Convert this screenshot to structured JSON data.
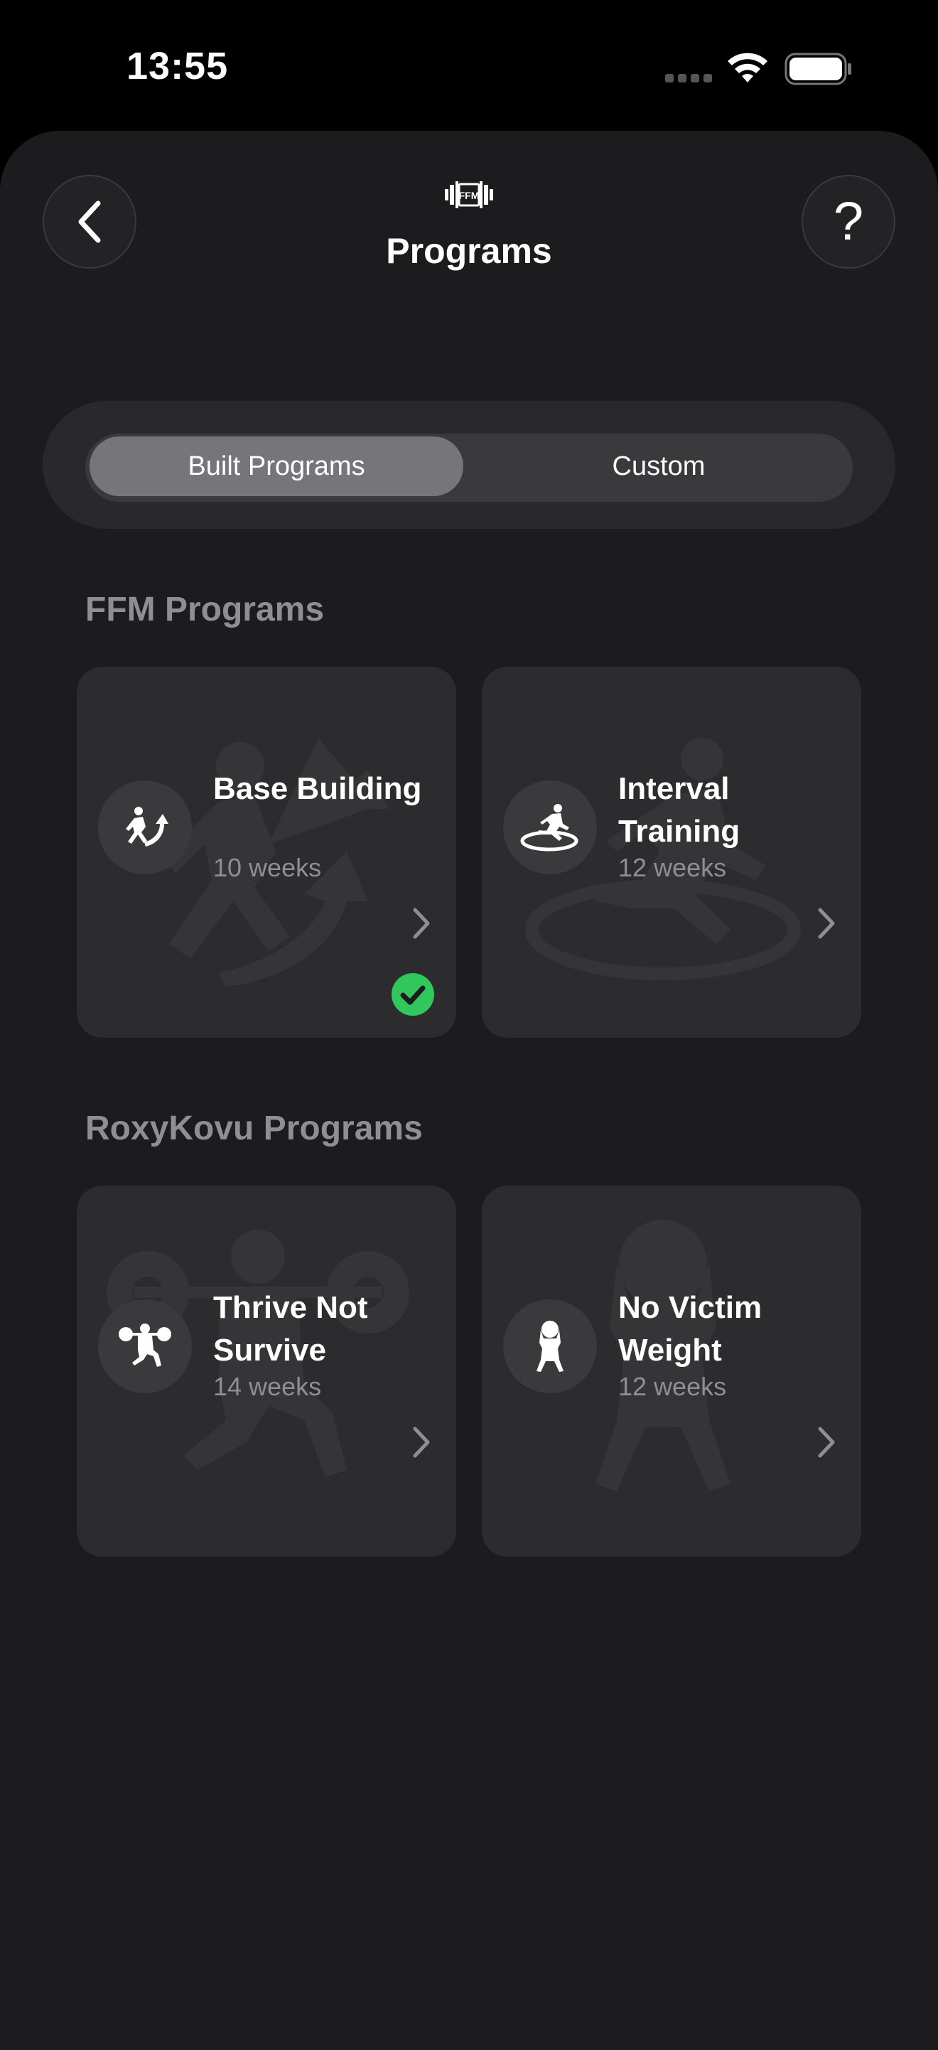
{
  "status_bar": {
    "time": "13:55"
  },
  "header": {
    "title": "Programs",
    "back_icon": "chevron-left-icon",
    "help_label": "?",
    "logo_icon": "ffm-barbell-logo-icon"
  },
  "segmented": {
    "options": [
      "Built Programs",
      "Custom"
    ],
    "selected": "Built Programs"
  },
  "sections": [
    {
      "title": "FFM Programs",
      "programs": [
        {
          "name": "Base Building",
          "duration": "10 weeks",
          "icon": "runner-arrow-icon",
          "selected": true
        },
        {
          "name": "Interval Training",
          "duration": "12 weeks",
          "icon": "runner-track-icon",
          "selected": false
        }
      ]
    },
    {
      "title": "RoxyKovu Programs",
      "programs": [
        {
          "name": "Thrive Not Survive",
          "duration": "14 weeks",
          "icon": "weightlifter-icon",
          "selected": false
        },
        {
          "name": "No Victim Weight",
          "duration": "12 weeks",
          "icon": "atlas-stone-icon",
          "selected": false
        }
      ]
    }
  ],
  "colors": {
    "background": "#1c1c1e",
    "card": "#2c2c2e",
    "segment_selected": "#76767a",
    "check_green": "#30c85a",
    "muted_text": "#8e8e93"
  }
}
